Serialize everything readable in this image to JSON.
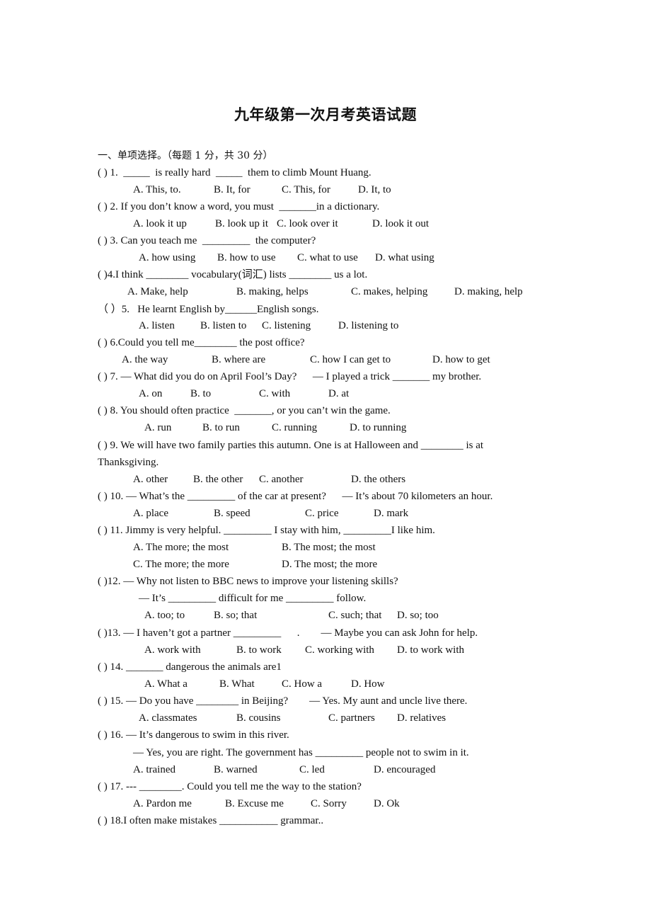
{
  "document": {
    "title": "九年级第一次月考英语试题",
    "section_heading": "一、单项选择。（每题 1 分，共 30 分）",
    "questions": [
      {
        "number": "1",
        "stem": "( ) 1.  _____  is really hard  _____  them to climb Mount Huang.",
        "options": [
          "A. This, to.",
          "B. It, for",
          "C. This, for",
          "D. It, to"
        ]
      },
      {
        "number": "2",
        "stem": "( ) 2. If you don’t know a word, you must  _______in a dictionary.",
        "options": [
          "A. look it up",
          "B. look up it",
          "C. look over it",
          "D. look it out"
        ]
      },
      {
        "number": "3",
        "stem": "( ) 3. Can you teach me  _________  the computer?",
        "options": [
          "A. how using",
          "B. how to use",
          "C. what to use",
          "D. what using"
        ]
      },
      {
        "number": "4",
        "stem": "( )4.I think ________ vocabulary(词汇) lists ________ us a lot.",
        "options": [
          "A. Make, help",
          "B. making, helps",
          "C. makes, helping",
          "D. making, help"
        ]
      },
      {
        "number": "5",
        "stem": "（ ）5.   He learnt English by______English songs.",
        "options": [
          "A. listen",
          "B. listen to",
          "C. listening",
          "D. listening to"
        ]
      },
      {
        "number": "6",
        "stem": "( ) 6.Could you tell me________ the post office?",
        "options": [
          "A. the way",
          "B. where are",
          "C. how I can get to",
          "D. how to get"
        ]
      },
      {
        "number": "7",
        "stem": "( ) 7. — What did you do on April Fool’s Day?      — I played a trick _______ my brother.",
        "options": [
          "A. on",
          "B. to",
          "C. with",
          "D. at"
        ]
      },
      {
        "number": "8",
        "stem": "( ) 8. You should often practice  _______, or you can’t win the game.",
        "options": [
          "A. run",
          "B. to run",
          "C. running",
          "D. to running"
        ]
      },
      {
        "number": "9",
        "stem": "( ) 9. We will have two family parties this autumn. One is at Halloween and ________ is at",
        "stem_continued": "Thanksgiving.",
        "options": [
          "A. other",
          "B. the other",
          "C. another",
          "D. the others"
        ]
      },
      {
        "number": "10",
        "stem": "( ) 10. — What’s the _________ of the car at present?      — It’s about 70 kilometers an hour.",
        "options": [
          "A. place",
          "B. speed",
          "C. price",
          "D. mark"
        ]
      },
      {
        "number": "11",
        "stem": "( ) 11. Jimmy is very helpful. _________ I stay with him, _________I like him.",
        "options": [
          "A. The more; the most",
          "B. The most; the most",
          "C. The more; the more",
          "D. The most; the more"
        ]
      },
      {
        "number": "12",
        "stem": "( )12. — Why not listen to BBC news to improve your listening skills?",
        "stem_continued": "— It’s _________ difficult for me _________ follow.",
        "options": [
          "A. too; to",
          "B. so; that",
          "C. such; that",
          "D. so; too"
        ]
      },
      {
        "number": "13",
        "stem": "( )13. — I haven’t got a partner _________      .        — Maybe you can ask John for help.",
        "options": [
          "A. work with",
          "B. to work",
          "C. working with",
          "D. to work with"
        ]
      },
      {
        "number": "14",
        "stem": "( ) 14. _______ dangerous the animals are1",
        "options": [
          "A. What a",
          "B. What",
          "C. How a",
          "D. How"
        ]
      },
      {
        "number": "15",
        "stem": "( ) 15. — Do you have ________ in Beijing?        — Yes. My aunt and uncle live there.",
        "options": [
          "A. classmates",
          "B. cousins",
          "C. partners",
          "D. relatives"
        ]
      },
      {
        "number": "16",
        "stem": "( ) 16. — It’s dangerous to swim in this river.",
        "stem_continued": "— Yes, you are right. The government has _________ people not to swim in it.",
        "options": [
          "A. trained",
          "B. warned",
          "C. led",
          "D. encouraged"
        ]
      },
      {
        "number": "17",
        "stem": "( ) 17. --- ________. Could you tell me the way to the station?",
        "options": [
          "A. Pardon me",
          "B. Excuse me",
          "C. Sorry",
          "D. Ok"
        ]
      },
      {
        "number": "18",
        "stem": "( ) 18.I often make mistakes ___________ grammar..",
        "options": []
      }
    ]
  }
}
